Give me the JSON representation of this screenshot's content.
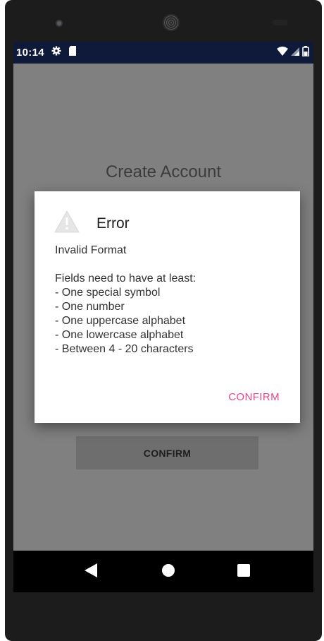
{
  "status_bar": {
    "time": "10:14",
    "left_icons": [
      "gear-icon",
      "sd-card-icon"
    ],
    "right_icons": [
      "wifi-icon",
      "signal-icon",
      "battery-icon"
    ]
  },
  "screen": {
    "title": "Create Account",
    "confirm_button": "CONFIRM"
  },
  "dialog": {
    "icon": "warning-icon",
    "title": "Error",
    "message_lines": [
      "Invalid Format",
      "",
      "Fields need to have at least:",
      "- One special symbol",
      "- One number",
      "- One uppercase alphabet",
      "- One lowercase alphabet",
      "- Between 4 - 20 characters"
    ],
    "confirm_label": "CONFIRM",
    "accent_color": "#e8468c"
  },
  "nav_bar": {
    "buttons": [
      "back-icon",
      "home-icon",
      "recents-icon"
    ]
  }
}
